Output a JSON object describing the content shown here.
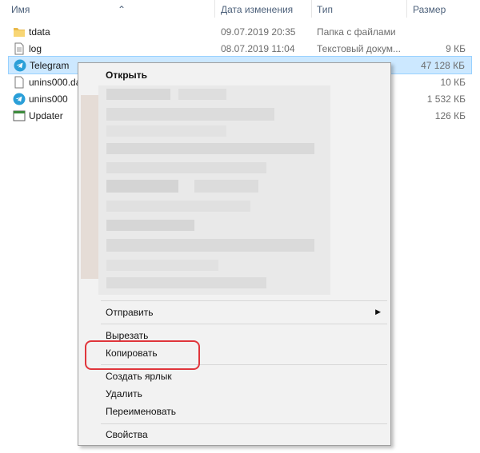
{
  "columns": {
    "name": "Имя",
    "date": "Дата изменения",
    "type": "Тип",
    "size": "Размер"
  },
  "files": [
    {
      "name": "tdata",
      "date": "09.07.2019 20:35",
      "type": "Папка с файлами",
      "size": "",
      "icon": "folder-icon",
      "selected": false
    },
    {
      "name": "log",
      "date": "08.07.2019 11:04",
      "type": "Текстовый докум...",
      "size": "9 КБ",
      "icon": "text-file-icon",
      "selected": false
    },
    {
      "name": "Telegram",
      "date": "",
      "type": "",
      "size": "47 128 КБ",
      "icon": "telegram-icon",
      "selected": true
    },
    {
      "name": "unins000.dat",
      "date": "",
      "type": "",
      "size": "10 КБ",
      "icon": "file-icon",
      "selected": false
    },
    {
      "name": "unins000",
      "date": "",
      "type": "",
      "size": "1 532 КБ",
      "icon": "telegram-icon",
      "selected": false
    },
    {
      "name": "Updater",
      "date": "",
      "type": "",
      "size": "126 КБ",
      "icon": "app-icon",
      "selected": false
    }
  ],
  "context_menu": {
    "open": "Открыть",
    "send": "Отправить",
    "cut": "Вырезать",
    "copy": "Копировать",
    "create_shortcut": "Создать ярлык",
    "delete": "Удалить",
    "rename": "Переименовать",
    "properties": "Свойства"
  },
  "colors": {
    "selection": "#cce8ff",
    "highlight": "#e0353b",
    "telegram": "#2a9fd8",
    "folder": "#e9b949"
  }
}
